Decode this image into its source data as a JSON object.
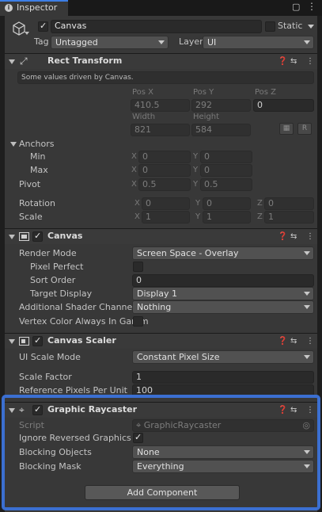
{
  "tab": {
    "title": "Inspector"
  },
  "object": {
    "name": "Canvas",
    "static_label": "Static",
    "tag_label": "Tag",
    "tag_value": "Untagged",
    "layer_label": "Layer",
    "layer_value": "UI"
  },
  "rect_transform": {
    "title": "Rect Transform",
    "notice": "Some values driven by Canvas.",
    "pos_x_label": "Pos X",
    "pos_y_label": "Pos Y",
    "pos_z_label": "Pos Z",
    "pos_x": "410.5",
    "pos_y": "292",
    "pos_z": "0",
    "width_label": "Width",
    "height_label": "Height",
    "width": "821",
    "height": "584",
    "r_button": "R",
    "anchors_label": "Anchors",
    "min_label": "Min",
    "max_label": "Max",
    "pivot_label": "Pivot",
    "anchor_min_x": "0",
    "anchor_min_y": "0",
    "anchor_max_x": "0",
    "anchor_max_y": "0",
    "pivot_x": "0.5",
    "pivot_y": "0.5",
    "rotation_label": "Rotation",
    "scale_label": "Scale",
    "rot_x": "0",
    "rot_y": "0",
    "rot_z": "0",
    "scale_x": "1",
    "scale_y": "1",
    "scale_z": "1",
    "x": "X",
    "y": "Y",
    "z": "Z"
  },
  "canvas": {
    "title": "Canvas",
    "render_mode_label": "Render Mode",
    "render_mode": "Screen Space - Overlay",
    "pixel_perfect_label": "Pixel Perfect",
    "sort_order_label": "Sort Order",
    "sort_order": "0",
    "target_display_label": "Target Display",
    "target_display": "Display 1",
    "shader_channels_label": "Additional Shader Channels",
    "shader_channels": "Nothing",
    "vertex_color_label": "Vertex Color Always In Gamm"
  },
  "canvas_scaler": {
    "title": "Canvas Scaler",
    "ui_scale_mode_label": "UI Scale Mode",
    "ui_scale_mode": "Constant Pixel Size",
    "scale_factor_label": "Scale Factor",
    "scale_factor": "1",
    "ref_ppu_label": "Reference Pixels Per Unit",
    "ref_ppu": "100"
  },
  "graphic_raycaster": {
    "title": "Graphic Raycaster",
    "script_label": "Script",
    "script_value": "GraphicRaycaster",
    "ignore_reversed_label": "Ignore Reversed Graphics",
    "blocking_objects_label": "Blocking Objects",
    "blocking_objects": "None",
    "blocking_mask_label": "Blocking Mask",
    "blocking_mask": "Everything"
  },
  "add_component": "Add Component",
  "colors": {
    "highlight": "#3b6fd1",
    "panel": "#383838",
    "header": "#3a3a3a"
  }
}
